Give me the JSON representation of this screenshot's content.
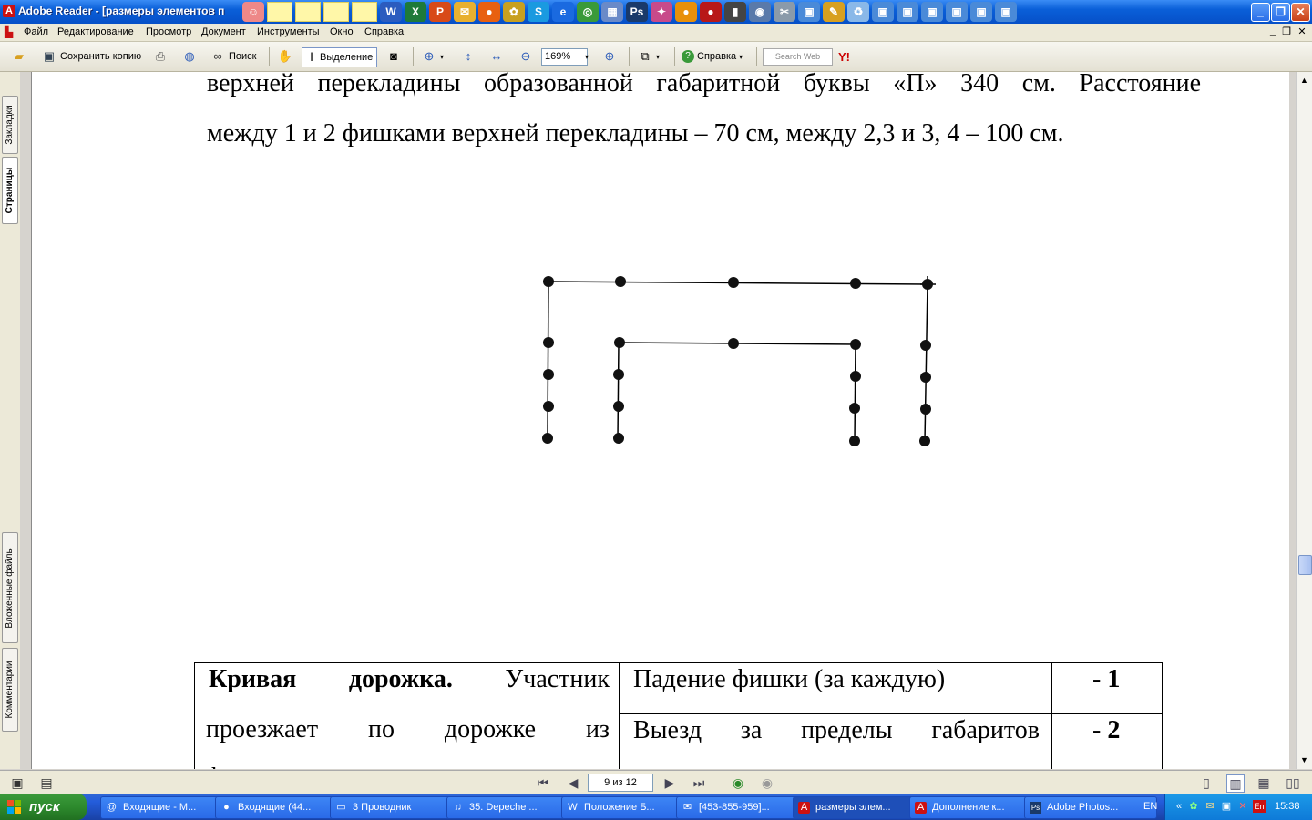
{
  "window": {
    "title": "Adobe Reader - [размеры элементов п",
    "app_icon": "A",
    "controls": [
      "_",
      "❐",
      "✕"
    ]
  },
  "menu": {
    "items": [
      "Файл",
      "Редактирование",
      "Просмотр",
      "Документ",
      "Инструменты",
      "Окно",
      "Справка"
    ]
  },
  "toolbar": {
    "save_copy": "Сохранить копию",
    "search": "Поиск",
    "select": "Выделение",
    "zoom": "169%",
    "help": "Справка",
    "search_web_placeholder": "Search Web",
    "yahoo": "Y!"
  },
  "side_tabs": {
    "bookmarks": "Закладки",
    "pages": "Страницы",
    "attachments": "Вложенные файлы",
    "comments": "Комментарии"
  },
  "document": {
    "line1": "верхней перекладины образованной габаритной буквы «П» 340 см. Расстояние",
    "line2": "между 1 и 2 фишками верхней перекладины – 70 см, между 2,3 и 3, 4 – 100 см.",
    "table": {
      "col1_bold": "Кривая дорожка.",
      "col1_rest_line1": "Участник",
      "col1_line2": "проезжает по дорожке из",
      "col1_line3": "ф",
      "row1_desc": "Падение фишки (за каждую)",
      "row1_points": "- 1",
      "row2_desc": "Выезд за пределы габаритов",
      "row2_points": "- 2"
    }
  },
  "navigation": {
    "page_indicator": "9 из 12"
  },
  "taskbar": {
    "start": "пуск",
    "tasks": [
      {
        "label": "Входящие - М...",
        "icon": "@"
      },
      {
        "label": "Входящие (44...",
        "icon": "●"
      },
      {
        "label": "3 Проводник",
        "icon": "▭"
      },
      {
        "label": "35. Depeche ...",
        "icon": "♫"
      },
      {
        "label": "Положение Б...",
        "icon": "W"
      },
      {
        "label": "[453-855-959]...",
        "icon": "✉"
      },
      {
        "label": "размеры элем...",
        "icon": "A"
      },
      {
        "label": "Дополнение к...",
        "icon": "A"
      },
      {
        "label": "Adobe Photos...",
        "icon": "Ps"
      }
    ],
    "lang": "EN",
    "clock": "15:38"
  }
}
